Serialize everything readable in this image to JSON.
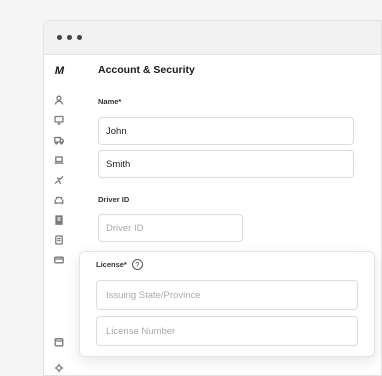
{
  "window": {
    "controls": [
      "close",
      "minimize",
      "maximize"
    ]
  },
  "sidebar": {
    "logo": "M",
    "items": [
      {
        "icon": "user-icon"
      },
      {
        "icon": "monitor-icon"
      },
      {
        "icon": "truck-icon"
      },
      {
        "icon": "laptop-icon"
      },
      {
        "icon": "plane-icon"
      },
      {
        "icon": "sofa-icon"
      },
      {
        "icon": "building-icon"
      },
      {
        "icon": "document-icon"
      },
      {
        "icon": "card-icon"
      }
    ],
    "bottom_items": [
      {
        "icon": "calendar-icon"
      },
      {
        "icon": "settings-icon"
      }
    ]
  },
  "page": {
    "title": "Account & Security",
    "name_label": "Name*",
    "first_name": "John",
    "last_name": "Smith",
    "driver_id_label": "Driver ID",
    "driver_id_placeholder": "Driver ID"
  },
  "license": {
    "label": "License*",
    "help_glyph": "?",
    "state_placeholder": "Issuing State/Province",
    "number_placeholder": "License Number"
  }
}
